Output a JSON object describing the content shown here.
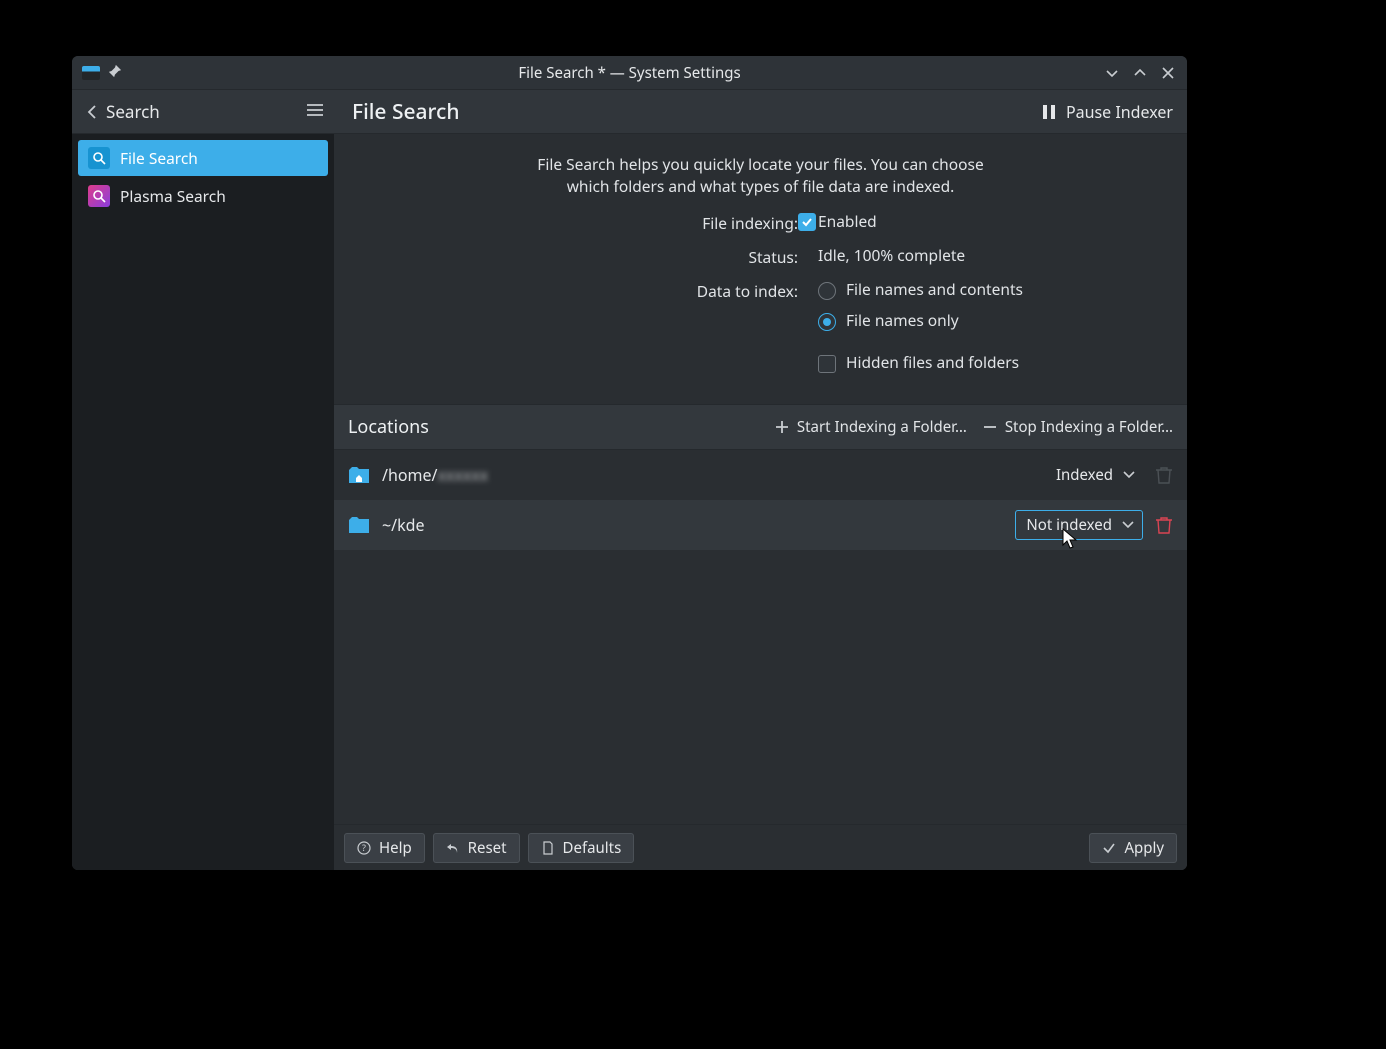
{
  "titlebar": {
    "title": "File Search * — System Settings"
  },
  "header": {
    "back_label": "Search",
    "page_title": "File Search",
    "pause_label": "Pause Indexer"
  },
  "sidebar": {
    "items": [
      {
        "label": "File Search"
      },
      {
        "label": "Plasma Search"
      }
    ]
  },
  "main": {
    "intro": "File Search helps you quickly locate your files. You can choose which folders and what types of file data are indexed.",
    "file_indexing_label": "File indexing:",
    "enabled_label": "Enabled",
    "status_label": "Status:",
    "status_value": "Idle, 100% complete",
    "data_label": "Data to index:",
    "opt_names_contents": "File names and contents",
    "opt_names_only": "File names only",
    "opt_hidden": "Hidden files and folders"
  },
  "locations": {
    "header": "Locations",
    "start_label": "Start Indexing a Folder…",
    "stop_label": "Stop Indexing a Folder…",
    "rows": [
      {
        "path_prefix": "/home/",
        "path_blur": "xxxxxx",
        "status": "Indexed"
      },
      {
        "path": "~/kde",
        "status": "Not indexed"
      }
    ]
  },
  "footer": {
    "help": "Help",
    "reset": "Reset",
    "defaults": "Defaults",
    "apply": "Apply"
  }
}
